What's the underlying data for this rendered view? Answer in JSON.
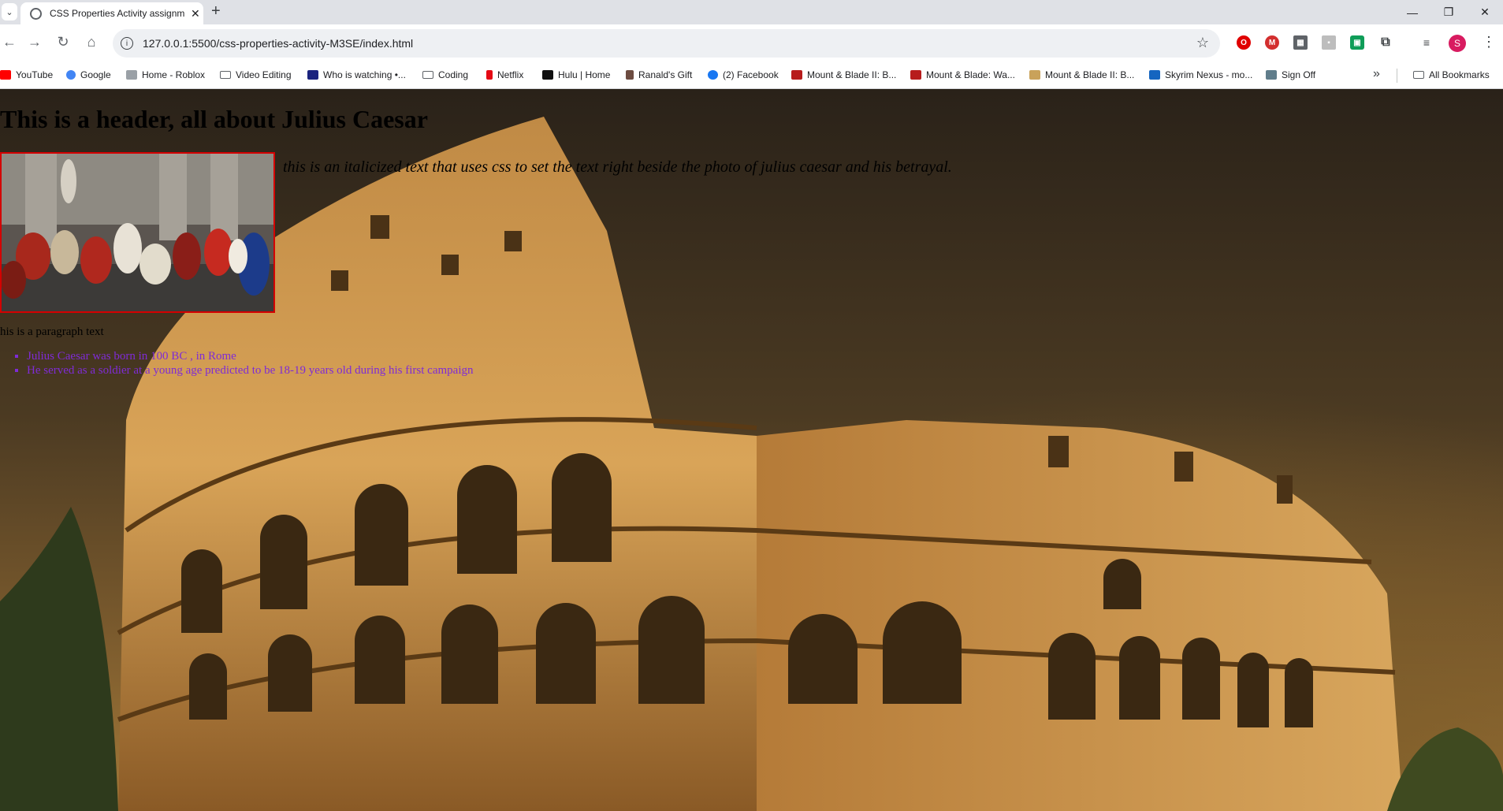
{
  "browser": {
    "tab_title": "CSS Properties Activity assignm",
    "url": "127.0.0.1:5500/css-properties-activity-M3SE/index.html",
    "profile_initial": "S",
    "bookmarks": [
      {
        "label": "YouTube",
        "icon": "youtube-icon",
        "color": "#ff0000"
      },
      {
        "label": "Google",
        "icon": "google-icon",
        "color": "#4285f4"
      },
      {
        "label": "Home - Roblox",
        "icon": "roblox-icon",
        "color": "#9aa0a6"
      },
      {
        "label": "Video Editing",
        "icon": "folder-icon",
        "color": "#5f6368"
      },
      {
        "label": "Who is watching •...",
        "icon": "m-icon",
        "color": "#1a237e"
      },
      {
        "label": "Coding",
        "icon": "folder-icon",
        "color": "#5f6368"
      },
      {
        "label": "Netflix",
        "icon": "netflix-icon",
        "color": "#e50914"
      },
      {
        "label": "Hulu | Home",
        "icon": "hulu-icon",
        "color": "#111111"
      },
      {
        "label": "Ranald's Gift",
        "icon": "ranald-icon",
        "color": "#6d4c41"
      },
      {
        "label": "(2) Facebook",
        "icon": "facebook-icon",
        "color": "#1877f2"
      },
      {
        "label": "Mount & Blade II: B...",
        "icon": "mb-icon",
        "color": "#b71c1c"
      },
      {
        "label": "Mount & Blade: Wa...",
        "icon": "mb-icon",
        "color": "#b71c1c"
      },
      {
        "label": "Mount & Blade II: B...",
        "icon": "mb2-icon",
        "color": "#c9a25a"
      },
      {
        "label": "Skyrim Nexus - mo...",
        "icon": "nexus-icon",
        "color": "#1565c0"
      },
      {
        "label": "Sign Off",
        "icon": "signoff-icon",
        "color": "#607d8b"
      }
    ],
    "all_bookmarks_label": "All Bookmarks"
  },
  "page": {
    "heading": "This is a header, all about Julius Caesar",
    "italic_text": "this is an italicized text that uses css to set the text right beside the photo of julius caesar and his betrayal.",
    "paragraph": "his is a paragraph text",
    "facts": [
      "Julius Caesar was born in 100 BC , in Rome",
      "He served as a soldier at a young age predicted to be 18-19 years old during his first campaign"
    ],
    "image_border_color": "#d40000",
    "list_color": "#7f2bd6"
  }
}
